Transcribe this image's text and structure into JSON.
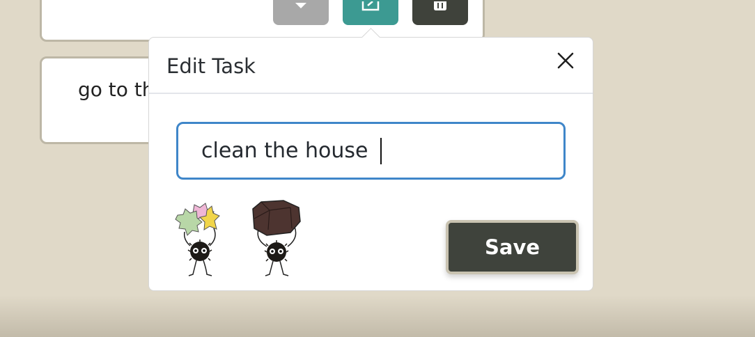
{
  "tasks": [
    {
      "text": ""
    },
    {
      "text": "go to the"
    }
  ],
  "popover": {
    "title": "Edit Task",
    "close_icon": "close-icon",
    "input_value": "clean the house ",
    "save_label": "Save"
  },
  "icons": {
    "complete": "check-icon",
    "edit": "edit-icon",
    "delete": "trash-icon"
  },
  "colors": {
    "background": "#e0d9c8",
    "edit_button": "#3c9a92",
    "delete_button": "#3f423b",
    "complete_button": "#a8a8a8",
    "save_button": "#3f433c",
    "input_border": "#3f86c9"
  }
}
